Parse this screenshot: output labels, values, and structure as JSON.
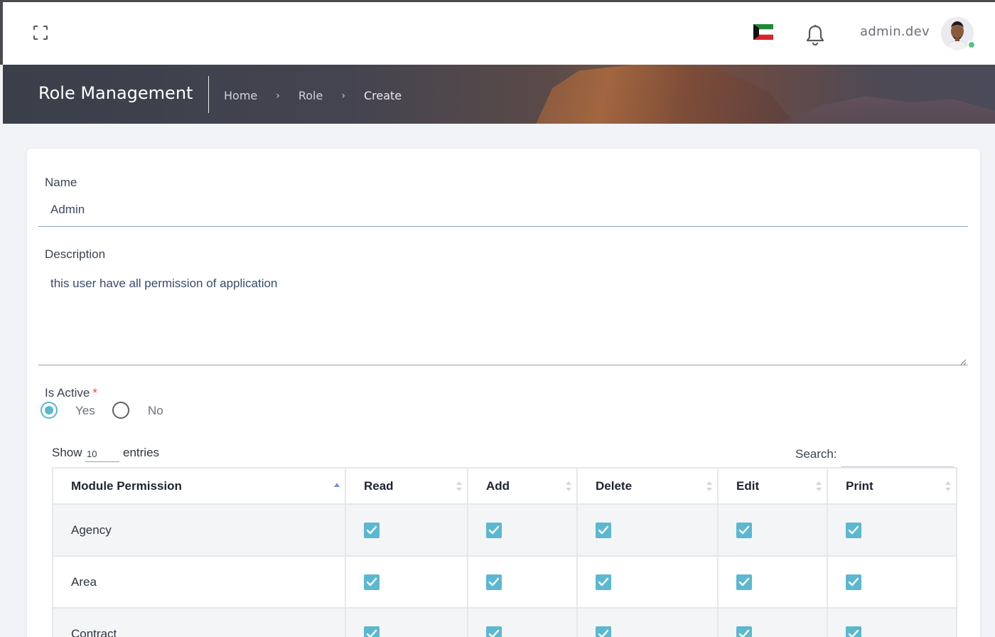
{
  "header": {
    "username": "admin.dev",
    "icons": {
      "expand": "fullscreen-icon",
      "flag": "kuwait-flag-icon",
      "notifications": "bell-icon",
      "avatar": "user-avatar"
    }
  },
  "banner": {
    "title": "Role Management",
    "breadcrumb": [
      "Home",
      "Role",
      "Create"
    ]
  },
  "form": {
    "name_label": "Name",
    "name_value": "Admin",
    "description_label": "Description",
    "description_value": "this user have all permission of application",
    "is_active_label": "Is Active",
    "required_mark": "*",
    "options": [
      {
        "label": "Yes",
        "checked": true
      },
      {
        "label": "No",
        "checked": false
      }
    ]
  },
  "table_controls": {
    "show_label": "Show",
    "entries_value": "10",
    "entries_label": "entries",
    "search_label": "Search:"
  },
  "table": {
    "columns": [
      "Module Permission",
      "Read",
      "Add",
      "Delete",
      "Edit",
      "Print"
    ],
    "rows": [
      {
        "module": "Agency",
        "read": true,
        "add": true,
        "delete": true,
        "edit": true,
        "print": true
      },
      {
        "module": "Area",
        "read": true,
        "add": true,
        "delete": true,
        "edit": true,
        "print": true
      },
      {
        "module": "Contract",
        "read": true,
        "add": true,
        "delete": true,
        "edit": true,
        "print": true
      }
    ]
  },
  "colors": {
    "accent": "#5bb8d0",
    "required": "#e24b4b",
    "online": "#5cc486"
  }
}
